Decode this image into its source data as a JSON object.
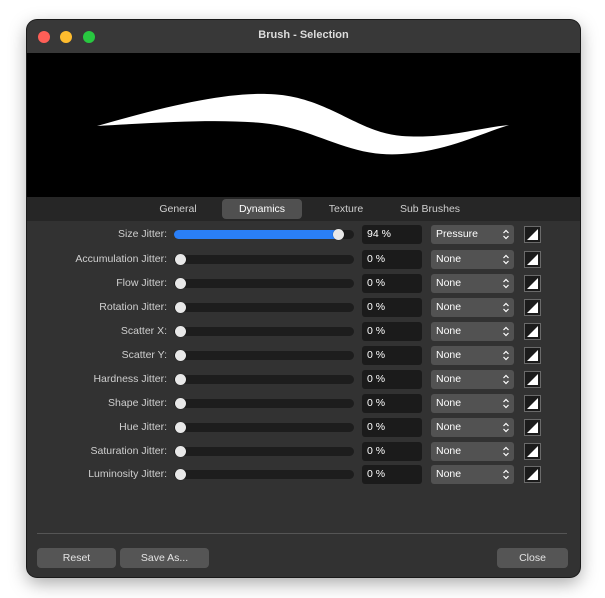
{
  "window": {
    "title": "Brush - Selection"
  },
  "tabs": [
    {
      "label": "General"
    },
    {
      "label": "Dynamics"
    },
    {
      "label": "Texture"
    },
    {
      "label": "Sub Brushes"
    }
  ],
  "active_tab": "Dynamics",
  "rows": [
    {
      "label": "Size Jitter:",
      "value": "94 %",
      "mode": "Pressure",
      "level": 0.94
    },
    {
      "label": "Accumulation Jitter:",
      "value": "0 %",
      "mode": "None",
      "level": 0
    },
    {
      "label": "Flow Jitter:",
      "value": "0 %",
      "mode": "None",
      "level": 0
    },
    {
      "label": "Rotation Jitter:",
      "value": "0 %",
      "mode": "None",
      "level": 0
    },
    {
      "label": "Scatter X:",
      "value": "0 %",
      "mode": "None",
      "level": 0
    },
    {
      "label": "Scatter Y:",
      "value": "0 %",
      "mode": "None",
      "level": 0
    },
    {
      "label": "Hardness Jitter:",
      "value": "0 %",
      "mode": "None",
      "level": 0
    },
    {
      "label": "Shape Jitter:",
      "value": "0 %",
      "mode": "None",
      "level": 0
    },
    {
      "label": "Hue Jitter:",
      "value": "0 %",
      "mode": "None",
      "level": 0
    },
    {
      "label": "Saturation Jitter:",
      "value": "0 %",
      "mode": "None",
      "level": 0
    },
    {
      "label": "Luminosity Jitter:",
      "value": "0 %",
      "mode": "None",
      "level": 0
    }
  ],
  "buttons": {
    "reset": "Reset",
    "save_as": "Save As...",
    "close": "Close"
  },
  "colors": {
    "accent": "#2a7ff7",
    "window_bg": "#323232",
    "preview_bg": "#000000"
  }
}
